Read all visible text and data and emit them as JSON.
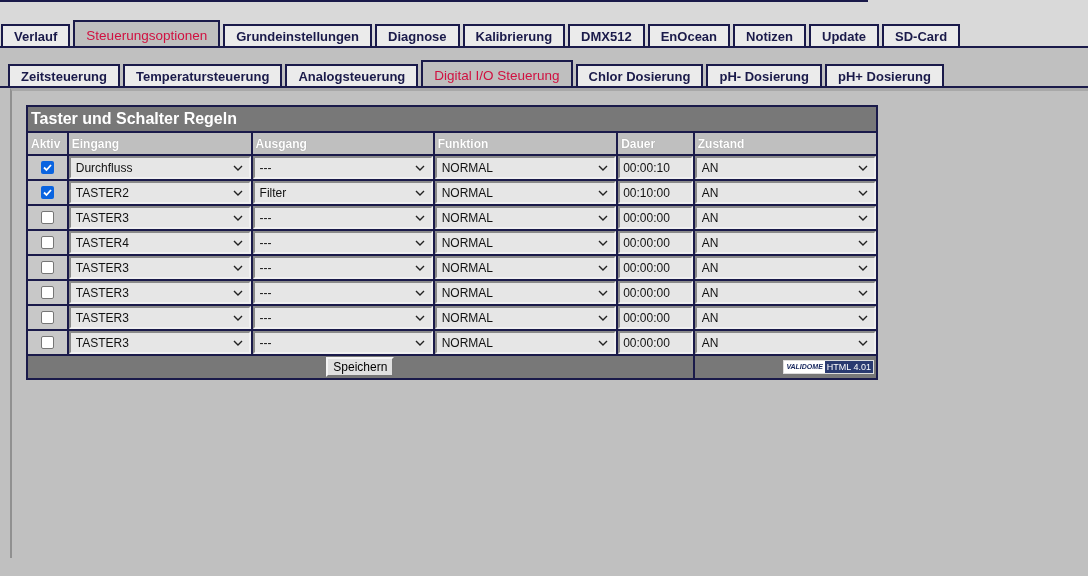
{
  "main_tabs": [
    {
      "label": "Verlauf",
      "selected": false
    },
    {
      "label": "Steuerungsoptionen",
      "selected": true
    },
    {
      "label": "Grundeinstellungen",
      "selected": false
    },
    {
      "label": "Diagnose",
      "selected": false
    },
    {
      "label": "Kalibrierung",
      "selected": false
    },
    {
      "label": "DMX512",
      "selected": false
    },
    {
      "label": "EnOcean",
      "selected": false
    },
    {
      "label": "Notizen",
      "selected": false
    },
    {
      "label": "Update",
      "selected": false
    },
    {
      "label": "SD-Card",
      "selected": false
    }
  ],
  "sub_tabs": [
    {
      "label": "Zeitsteuerung",
      "selected": false
    },
    {
      "label": "Temperatursteuerung",
      "selected": false
    },
    {
      "label": "Analogsteuerung",
      "selected": false
    },
    {
      "label": "Digital I/O Steuerung",
      "selected": true
    },
    {
      "label": "Chlor Dosierung",
      "selected": false
    },
    {
      "label": "pH- Dosierung",
      "selected": false
    },
    {
      "label": "pH+ Dosierung",
      "selected": false
    }
  ],
  "table": {
    "title": "Taster und Schalter Regeln",
    "columns": [
      "Aktiv",
      "Eingang",
      "Ausgang",
      "Funktion",
      "Dauer",
      "Zustand"
    ],
    "rows": [
      {
        "checked": true,
        "input": "Durchfluss",
        "output": "---",
        "function": "NORMAL",
        "duration": "00:00:10",
        "state": "AN"
      },
      {
        "checked": true,
        "input": "TASTER2",
        "output": "Filter",
        "function": "NORMAL",
        "duration": "00:10:00",
        "state": "AN"
      },
      {
        "checked": false,
        "input": "TASTER3",
        "output": "---",
        "function": "NORMAL",
        "duration": "00:00:00",
        "state": "AN"
      },
      {
        "checked": false,
        "input": "TASTER4",
        "output": "---",
        "function": "NORMAL",
        "duration": "00:00:00",
        "state": "AN"
      },
      {
        "checked": false,
        "input": "TASTER3",
        "output": "---",
        "function": "NORMAL",
        "duration": "00:00:00",
        "state": "AN"
      },
      {
        "checked": false,
        "input": "TASTER3",
        "output": "---",
        "function": "NORMAL",
        "duration": "00:00:00",
        "state": "AN"
      },
      {
        "checked": false,
        "input": "TASTER3",
        "output": "---",
        "function": "NORMAL",
        "duration": "00:00:00",
        "state": "AN"
      },
      {
        "checked": false,
        "input": "TASTER3",
        "output": "---",
        "function": "NORMAL",
        "duration": "00:00:00",
        "state": "AN"
      }
    ],
    "save_button": "Speichern",
    "badge": {
      "logo": "VALIDOME",
      "label": "HTML 4.01"
    }
  }
}
